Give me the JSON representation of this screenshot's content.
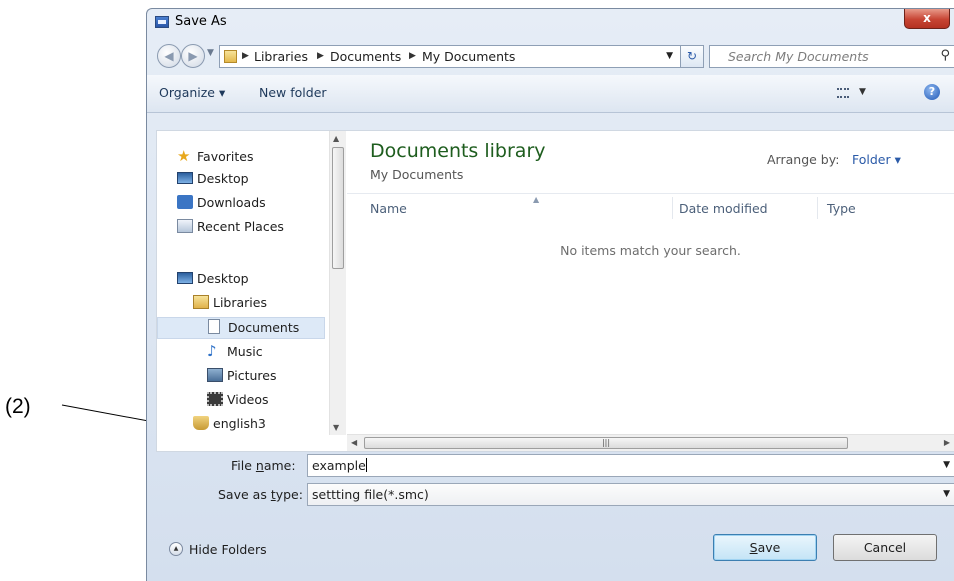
{
  "callout": {
    "label": "(2)"
  },
  "window": {
    "title": "Save As",
    "close_label": "x"
  },
  "address": {
    "crumbs": [
      "Libraries",
      "Documents",
      "My Documents"
    ],
    "search_placeholder": "Search My Documents"
  },
  "toolbar": {
    "organize_label": "Organize ▾",
    "new_folder_label": "New folder"
  },
  "nav": {
    "favorites": "Favorites",
    "fav_desktop": "Desktop",
    "fav_downloads": "Downloads",
    "fav_recent": "Recent Places",
    "desktop": "Desktop",
    "libraries": "Libraries",
    "documents": "Documents",
    "music": "Music",
    "pictures": "Pictures",
    "videos": "Videos",
    "user": "english3"
  },
  "files": {
    "library_title": "Documents library",
    "library_subtitle": "My Documents",
    "arrange_label": "Arrange by:",
    "arrange_value": "Folder ▾",
    "columns": [
      "Name",
      "Date modified",
      "Type"
    ],
    "empty_message": "No items match your search."
  },
  "form": {
    "file_name_label_pre": "File ",
    "file_name_label_key": "n",
    "file_name_label_post": "ame:",
    "file_name_value": "example",
    "save_type_label_pre": "Save as ",
    "save_type_label_key": "t",
    "save_type_label_post": "ype:",
    "save_type_value": "settting file(*.smc)"
  },
  "footer": {
    "hide_folders": "Hide Folders",
    "save_key": "S",
    "save_rest": "ave",
    "cancel": "Cancel"
  },
  "colors": {
    "library_title": "#1e5d1e",
    "accent_link": "#2a5aa8",
    "close_button": "#c74433"
  }
}
